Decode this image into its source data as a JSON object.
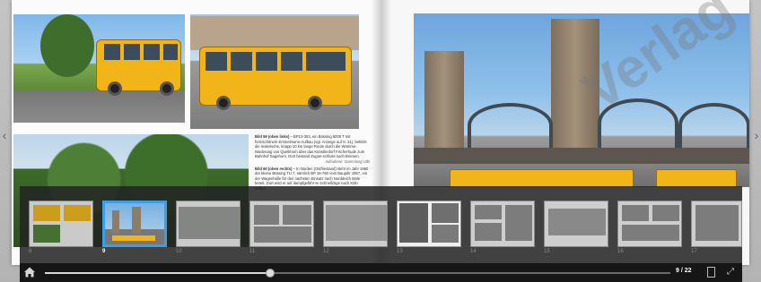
{
  "book": {
    "left_page": {
      "caption_59_label": "Bild 59 (oben links)",
      "caption_59_text": " – BP13-353, ein Büssing 6000 T mit formschönem Emmelmann-Aufbau (vgl. Anzeige auf S. 21), befährt die malerische, knapp 10 km lange Route durch die Wümme-Niederung von Quelkhorn über das Künstlerdorf Fischerhude zum Bahnhof Sagehorn. Dort bestand Zugan-schluss nach Bremen.",
      "caption_59_credit": "Aufnahme: Sammlung Ulbl",
      "caption_60_label": "Bild 60 (oben rechts)",
      "caption_60_text": " – In Norden (Ostfriesland) steht im Jahr 1960 der kleine Büssing TU 7, nämlich BP 15-760 vom Baujahr 1957, vor der Wagenhalle für den nächsten Einsatz nach Norddeich Mole bereit. Dort wird er auf dampfgeführ-te Schnellzüge nach Köln treffen."
    },
    "watermark": "Verlag"
  },
  "navigation": {
    "prev_arrow": "‹",
    "next_arrow": "›"
  },
  "thumbnails": [
    {
      "page": "8",
      "active": false
    },
    {
      "page": "9",
      "active": true
    },
    {
      "page": "10",
      "active": false
    },
    {
      "page": "11",
      "active": false
    },
    {
      "page": "12",
      "active": false
    },
    {
      "page": "13",
      "active": false
    },
    {
      "page": "14",
      "active": false
    },
    {
      "page": "15",
      "active": false
    },
    {
      "page": "16",
      "active": false
    },
    {
      "page": "17",
      "active": false
    }
  ],
  "controls": {
    "page_indicator": "9 / 22",
    "slider_progress": 0.36,
    "home_icon": "home-icon",
    "single_page_icon": "single-page-icon",
    "fullscreen_icon": "fullscreen-icon"
  }
}
